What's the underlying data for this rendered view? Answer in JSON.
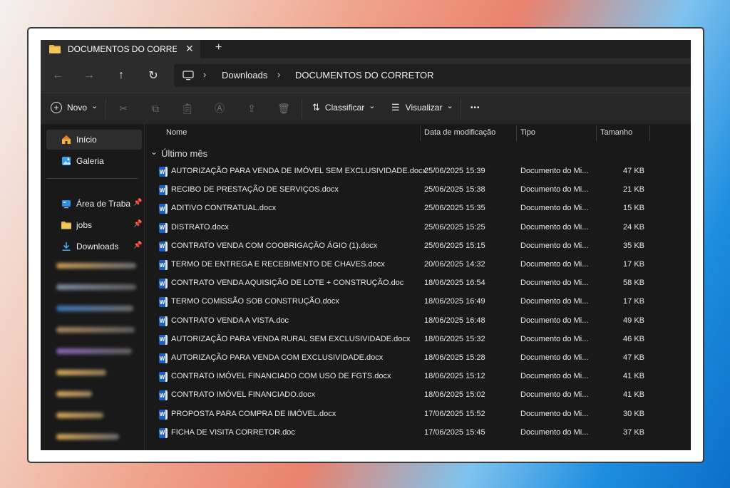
{
  "tab": {
    "title": "DOCUMENTOS DO CORRETOR",
    "close": "✕",
    "new_tab": "+"
  },
  "nav": {
    "back": "←",
    "forward": "→",
    "up": "↑",
    "refresh": "↻"
  },
  "address": {
    "crumbs": [
      "Downloads",
      "DOCUMENTOS DO CORRETOR"
    ],
    "separator": "›"
  },
  "toolbar": {
    "new_label": "Novo",
    "sort_label": "Classificar",
    "view_label": "Visualizar",
    "more": "•••",
    "chevron": "⌄"
  },
  "sidebar": {
    "items": [
      {
        "label": "Início",
        "icon": "home-icon"
      },
      {
        "label": "Galeria",
        "icon": "gallery-icon"
      }
    ],
    "pinned": [
      {
        "label": "Área de Trabalho",
        "icon": "desktop-icon",
        "pin": "📌"
      },
      {
        "label": "jobs",
        "icon": "folder-icon",
        "pin": "📌"
      },
      {
        "label": "Downloads",
        "icon": "download-icon",
        "pin": "📌"
      }
    ]
  },
  "columns": {
    "name": "Nome",
    "date": "Data de modificação",
    "type": "Tipo",
    "size": "Tamanho"
  },
  "group": {
    "label": "Último mês",
    "chevron": "⌄"
  },
  "files": [
    {
      "name": "AUTORIZAÇÃO PARA VENDA DE IMÓVEL SEM EXCLUSIVIDADE.docx",
      "date": "25/06/2025 15:39",
      "type": "Documento do Mi...",
      "size": "47 KB"
    },
    {
      "name": "RECIBO DE PRESTAÇÃO DE SERVIÇOS.docx",
      "date": "25/06/2025 15:38",
      "type": "Documento do Mi...",
      "size": "21 KB"
    },
    {
      "name": "ADITIVO CONTRATUAL.docx",
      "date": "25/06/2025 15:35",
      "type": "Documento do Mi...",
      "size": "15 KB"
    },
    {
      "name": "DISTRATO.docx",
      "date": "25/06/2025 15:25",
      "type": "Documento do Mi...",
      "size": "24 KB"
    },
    {
      "name": "CONTRATO VENDA COM COOBRIGAÇÃO ÁGIO (1).docx",
      "date": "25/06/2025 15:15",
      "type": "Documento do Mi...",
      "size": "35 KB"
    },
    {
      "name": "TERMO DE ENTREGA E RECEBIMENTO DE CHAVES.docx",
      "date": "20/06/2025 14:32",
      "type": "Documento do Mi...",
      "size": "17 KB"
    },
    {
      "name": "CONTRATO VENDA AQUISIÇÃO DE LOTE + CONSTRUÇÃO.doc",
      "date": "18/06/2025 16:54",
      "type": "Documento do Mi...",
      "size": "58 KB"
    },
    {
      "name": "TERMO COMISSÃO SOB CONSTRUÇÃO.docx",
      "date": "18/06/2025 16:49",
      "type": "Documento do Mi...",
      "size": "17 KB"
    },
    {
      "name": "CONTRATO VENDA A VISTA.doc",
      "date": "18/06/2025 16:48",
      "type": "Documento do Mi...",
      "size": "49 KB"
    },
    {
      "name": "AUTORIZAÇÃO PARA VENDA RURAL SEM EXCLUSIVIDADE.docx",
      "date": "18/06/2025 15:32",
      "type": "Documento do Mi...",
      "size": "46 KB"
    },
    {
      "name": "AUTORIZAÇÃO PARA VENDA COM EXCLUSIVIDADE.docx",
      "date": "18/06/2025 15:28",
      "type": "Documento do Mi...",
      "size": "47 KB"
    },
    {
      "name": "CONTRATO IMÓVEL FINANCIADO COM USO DE FGTS.docx",
      "date": "18/06/2025 15:12",
      "type": "Documento do Mi...",
      "size": "41 KB"
    },
    {
      "name": "CONTRATO IMÓVEL FINANCIADO.docx",
      "date": "18/06/2025 15:02",
      "type": "Documento do Mi...",
      "size": "41 KB"
    },
    {
      "name": "PROPOSTA PARA COMPRA DE IMÓVEL.docx",
      "date": "17/06/2025 15:52",
      "type": "Documento do Mi...",
      "size": "30 KB"
    },
    {
      "name": "FICHA DE VISITA CORRETOR.doc",
      "date": "17/06/2025 15:45",
      "type": "Documento do Mi...",
      "size": "37 KB"
    }
  ],
  "word_icon_letter": "W",
  "colors": {
    "accent_folder": "#e8b34a",
    "word_blue": "#1e5fbf",
    "window_bg": "#191919"
  }
}
